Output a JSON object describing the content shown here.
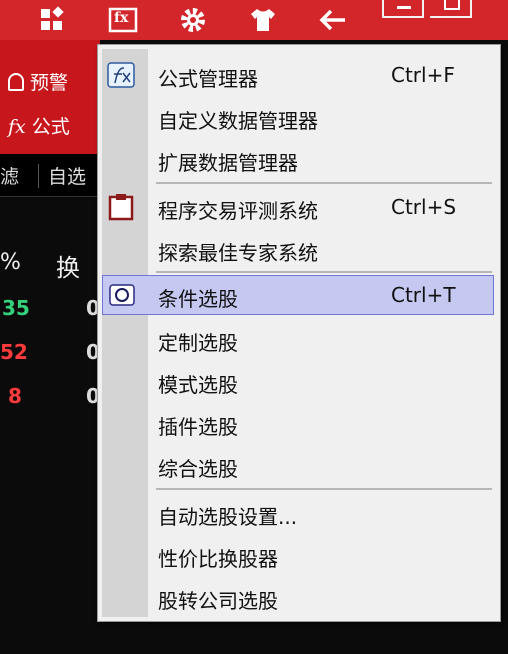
{
  "colors": {
    "accent": "#d3262b",
    "up": "#ff3b3b",
    "down": "#33d17a",
    "highlight": "#c5c9f2"
  },
  "toolbar": {
    "icons": [
      "grid-icon",
      "formula-icon",
      "gear-icon",
      "shirt-icon",
      "back-arrow-icon"
    ],
    "formula_glyph": "fx"
  },
  "left_panel": {
    "alert_label": "预警",
    "formula_label": "公式",
    "formula_glyph": "fx",
    "tabs": [
      "滤",
      "自选"
    ],
    "header_pct": "%",
    "header_turnover": "换",
    "rows": [
      {
        "pct": "35",
        "pct_color": "#33d17a",
        "turn": "0"
      },
      {
        "pct": "52",
        "pct_color": "#ff3b3b",
        "turn": "0"
      },
      {
        "pct": "8",
        "pct_color": "#ff3b3b",
        "turn": "0"
      }
    ]
  },
  "menu": {
    "items": [
      {
        "label": "公式管理器",
        "shortcut": "Ctrl+F",
        "icon": "formula-manager-icon"
      },
      {
        "label": "自定义数据管理器",
        "shortcut": ""
      },
      {
        "label": "扩展数据管理器",
        "shortcut": ""
      },
      {
        "label": "程序交易评测系统",
        "shortcut": "Ctrl+S",
        "icon": "clipboard-icon"
      },
      {
        "label": "探索最佳专家系统",
        "shortcut": ""
      },
      {
        "label": "条件选股",
        "shortcut": "Ctrl+T",
        "icon": "stock-screen-icon",
        "highlighted": true
      },
      {
        "label": "定制选股",
        "shortcut": ""
      },
      {
        "label": "模式选股",
        "shortcut": ""
      },
      {
        "label": "插件选股",
        "shortcut": ""
      },
      {
        "label": "综合选股",
        "shortcut": ""
      },
      {
        "label": "自动选股设置...",
        "shortcut": ""
      },
      {
        "label": "性价比换股器",
        "shortcut": ""
      },
      {
        "label": "股转公司选股",
        "shortcut": ""
      }
    ]
  }
}
